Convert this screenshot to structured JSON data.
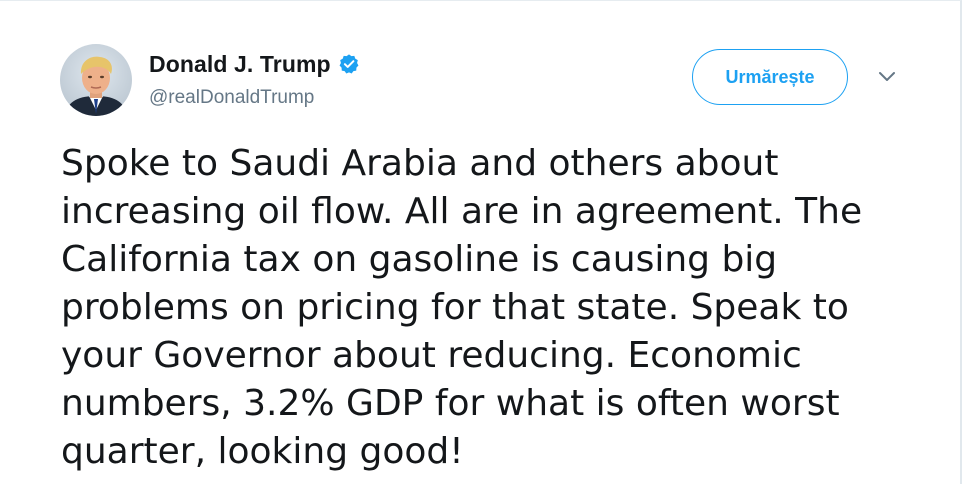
{
  "tweet": {
    "author": {
      "display_name": "Donald J. Trump",
      "handle": "@realDonaldTrump",
      "verified": true,
      "avatar_icon": "profile-photo-icon",
      "verified_icon": "verified-badge-icon"
    },
    "follow_button_label": "Urmărește",
    "menu_icon": "chevron-down-icon",
    "text_lines": [
      "Spoke to Saudi Arabia and others about",
      "increasing oil flow. All are in agreement. The",
      "California tax on gasoline is causing big",
      "problems on pricing for that state. Speak to",
      "your Governor about reducing. Economic",
      "numbers, 3.2% GDP for what is often worst",
      "quarter, looking good!"
    ]
  },
  "colors": {
    "accent": "#1da1f2",
    "text_primary": "#14171a",
    "text_secondary": "#657786"
  }
}
